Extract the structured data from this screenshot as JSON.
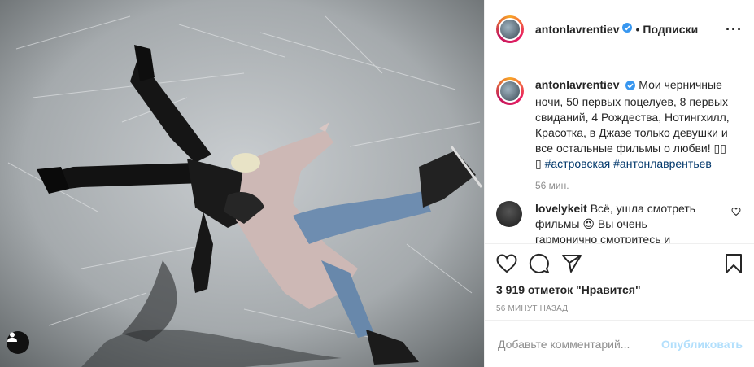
{
  "post": {
    "username": "antonlavrentiev",
    "dot": "•",
    "follow_label": "Подписки",
    "more_label": "···"
  },
  "caption": {
    "username": "antonlavrentiev",
    "text": "Мои черничные ночи, 50 первых поцелуев, 8 первых свиданий, 4 Рождества, Нотингхилл, Красотка, в Джазе только девушки и все остальные фильмы о любви! ",
    "symbols": "▯▯ ▯",
    "hashtag1": "#астровская",
    "hashtag2": "#антонлаврентьев",
    "time": "56 мин."
  },
  "comment": {
    "username": "lovelykeit",
    "text": "Всё, ушла смотреть фильмы 😍 Вы очень гармонично смотритесь и"
  },
  "stats": {
    "likes": "3 919 отметок \"Нравится\"",
    "ago": "56 МИНУТ НАЗАД"
  },
  "add_comment": {
    "placeholder": "Добавьте комментарий...",
    "publish_label": "Опубликовать"
  },
  "icons": {
    "verified": "verified-badge-icon",
    "like": "heart-icon",
    "comment": "speech-bubble-icon",
    "share": "paper-plane-icon",
    "save": "bookmark-icon",
    "tag": "person-tag-icon"
  },
  "colors": {
    "verified": "#3897f0",
    "link": "#00376b",
    "publish": "#b2dffc",
    "muted": "#8e8e8e"
  }
}
